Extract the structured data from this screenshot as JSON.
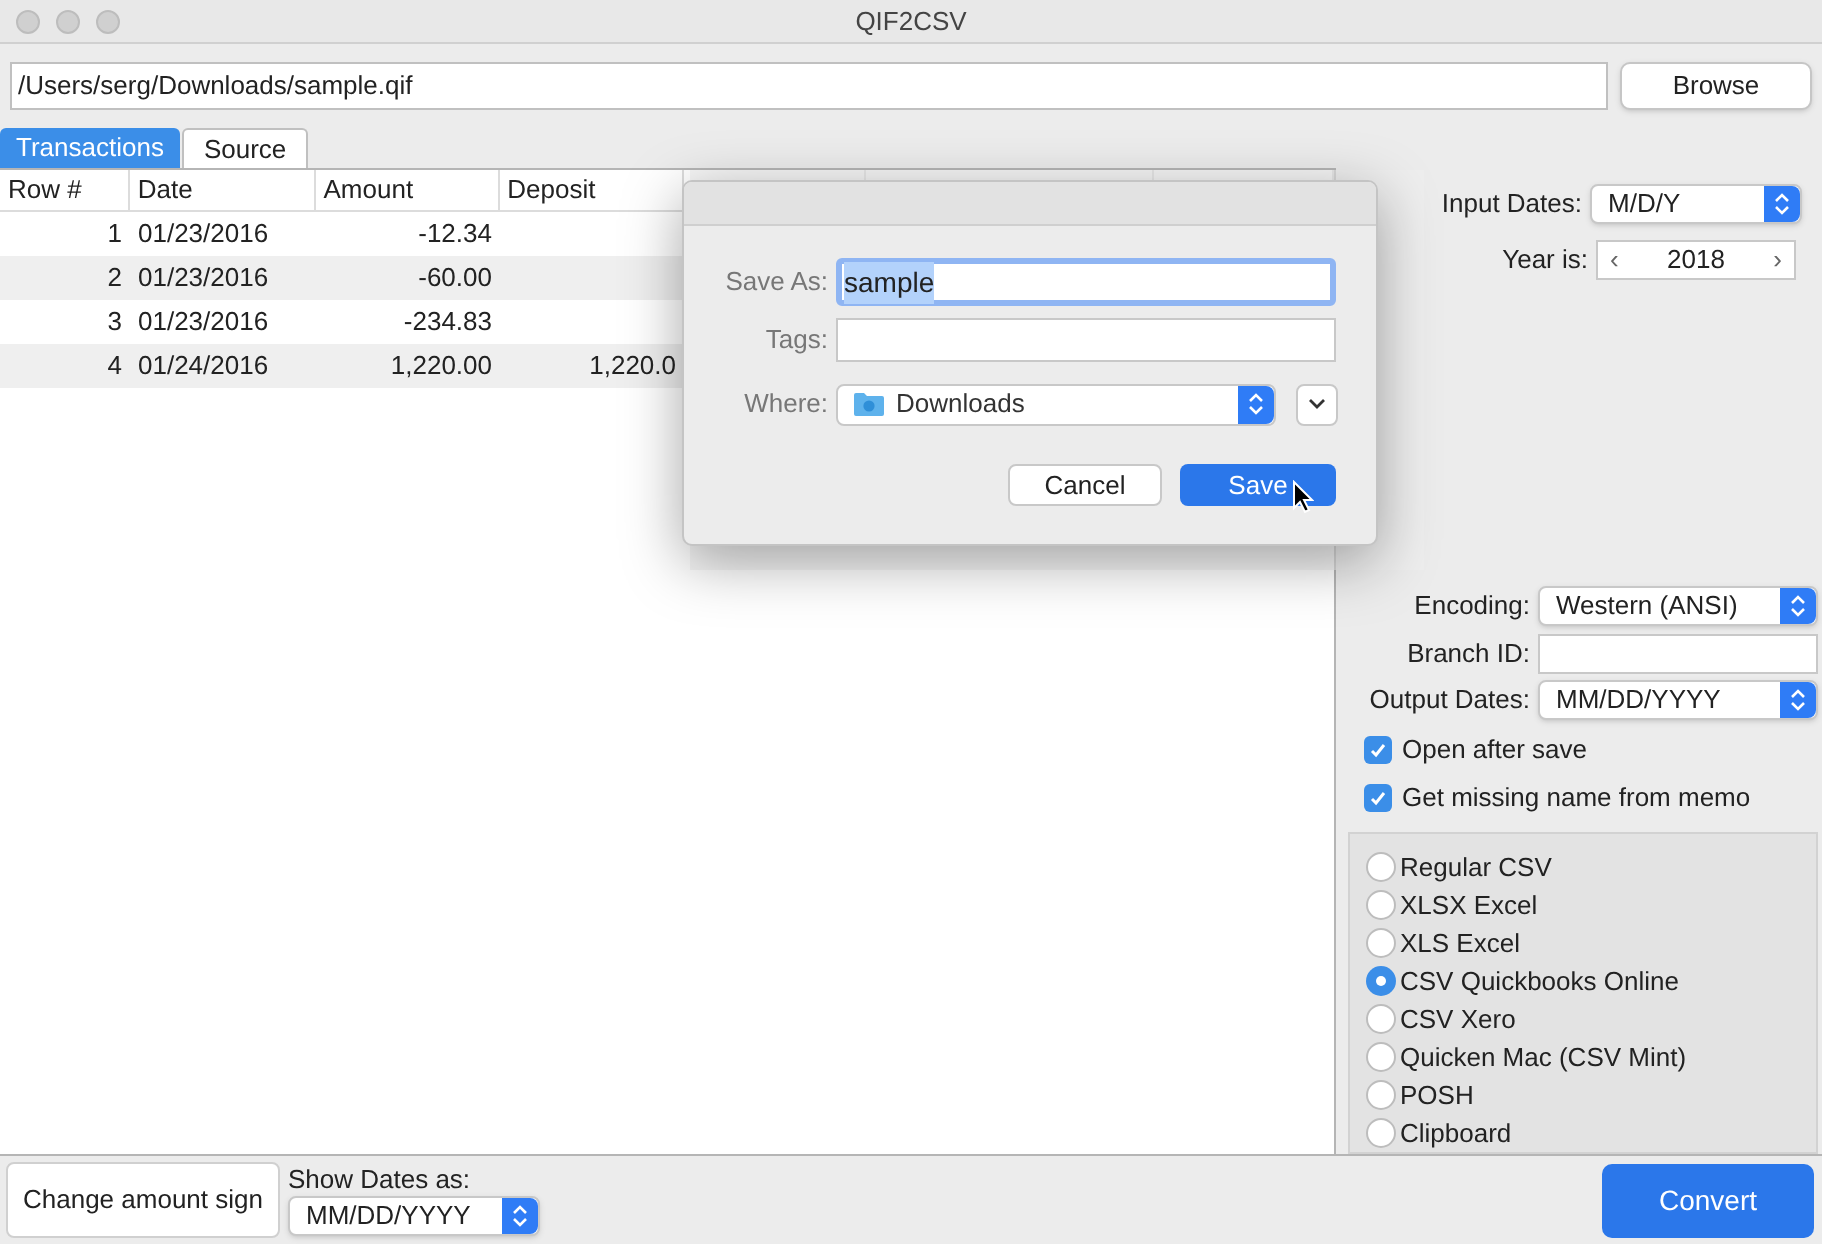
{
  "window": {
    "title": "QIF2CSV"
  },
  "file": {
    "path": "/Users/serg/Downloads/sample.qif",
    "browse": "Browse"
  },
  "tabs": [
    {
      "label": "Transactions",
      "selected": true
    },
    {
      "label": "Source",
      "selected": false
    }
  ],
  "table": {
    "columns": [
      "Row #",
      "Date",
      "Amount",
      "Deposit"
    ],
    "rows": [
      {
        "cells": [
          "1",
          "01/23/2016",
          "-12.34",
          ""
        ]
      },
      {
        "cells": [
          "2",
          "01/23/2016",
          "-60.00",
          ""
        ]
      },
      {
        "cells": [
          "3",
          "01/23/2016",
          "-234.83",
          ""
        ]
      },
      {
        "cells": [
          "4",
          "01/24/2016",
          "1,220.00",
          "1,220.0"
        ]
      }
    ]
  },
  "settings": {
    "input_dates": {
      "label": "Input Dates:",
      "value": "M/D/Y"
    },
    "year": {
      "label": "Year is:",
      "value": "2018",
      "prev": "‹",
      "next": "›"
    },
    "encoding": {
      "label": "Encoding:",
      "value": "Western (ANSI)"
    },
    "branch_id": {
      "label": "Branch ID:"
    },
    "output_dates": {
      "label": "Output Dates:",
      "value": "MM/DD/YYYY"
    },
    "checkboxes": [
      {
        "label": "Open after save",
        "checked": true
      },
      {
        "label": "Get missing name from memo",
        "checked": true
      }
    ],
    "formats": [
      {
        "label": "Regular CSV",
        "selected": false
      },
      {
        "label": "XLSX Excel",
        "selected": false
      },
      {
        "label": "XLS Excel",
        "selected": false
      },
      {
        "label": "CSV Quickbooks Online",
        "selected": true
      },
      {
        "label": "CSV Xero",
        "selected": false
      },
      {
        "label": "Quicken Mac (CSV Mint)",
        "selected": false
      },
      {
        "label": "POSH",
        "selected": false
      },
      {
        "label": "Clipboard",
        "selected": false
      }
    ],
    "convert": "Convert"
  },
  "bottom": {
    "change_sign": "Change amount sign",
    "show_dates": {
      "label": "Show Dates as:",
      "value": "MM/DD/YYYY"
    }
  },
  "save_dialog": {
    "save_as": {
      "label": "Save As:",
      "value": "sample"
    },
    "tags": {
      "label": "Tags:"
    },
    "where": {
      "label": "Where:",
      "value": "Downloads"
    },
    "cancel": "Cancel",
    "save": "Save"
  }
}
